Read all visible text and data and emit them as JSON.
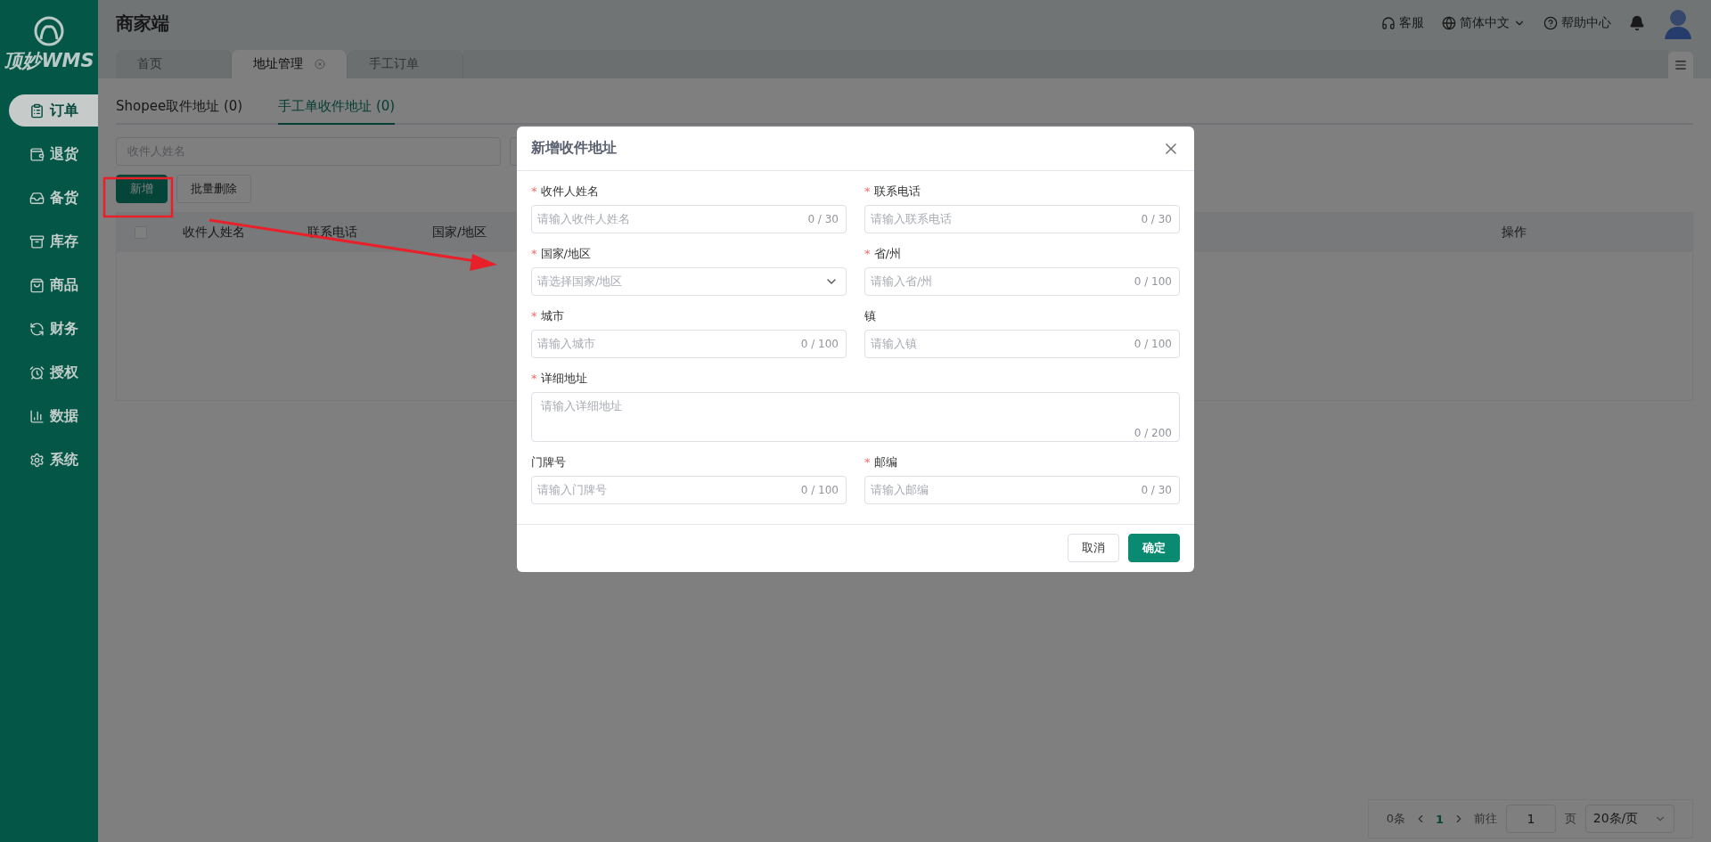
{
  "app": {
    "logo": "顶妙WMS",
    "title": "商家端"
  },
  "header_actions": [
    {
      "kind": "support",
      "label": "客服"
    },
    {
      "kind": "language",
      "label": "简体中文"
    },
    {
      "kind": "help",
      "label": "帮助中心"
    }
  ],
  "sidebar": {
    "items": [
      {
        "label": "订单",
        "selected": true
      },
      {
        "label": "退货",
        "selected": false
      },
      {
        "label": "备货",
        "selected": false
      },
      {
        "label": "库存",
        "selected": false
      },
      {
        "label": "商品",
        "selected": false
      },
      {
        "label": "财务",
        "selected": false
      },
      {
        "label": "授权",
        "selected": false
      },
      {
        "label": "数据",
        "selected": false
      },
      {
        "label": "系统",
        "selected": false
      }
    ]
  },
  "page_tabs": [
    {
      "label": "首页",
      "selected": false,
      "closable": false
    },
    {
      "label": "地址管理",
      "selected": true,
      "closable": true
    },
    {
      "label": "手工订单",
      "selected": false,
      "closable": false
    }
  ],
  "sub_tabs": [
    {
      "label": "Shopee取件地址 (0)",
      "selected": false
    },
    {
      "label": "手工单收件地址 (0)",
      "selected": true
    }
  ],
  "filter": {
    "placeholder": "收件人姓名"
  },
  "actions": [
    {
      "label": "新增",
      "kind": "primary",
      "highlighted": true
    },
    {
      "label": "批量删除",
      "kind": "default",
      "highlighted": false
    }
  ],
  "table": {
    "select_all": {
      "checked": false
    },
    "columns": [
      "收件人姓名",
      "联系电话",
      "国家/地区"
    ],
    "action_column": "操作"
  },
  "pagination": {
    "total": "0条",
    "pages": [
      {
        "label": "1",
        "selected": true
      }
    ],
    "goto_label": "前往",
    "goto_value": "1",
    "page_unit": "页",
    "page_size": "20条/页"
  },
  "dialog": {
    "title": "新增收件地址",
    "required_mark": "*",
    "fields": [
      {
        "kind": "input",
        "label": "收件人姓名",
        "required": true,
        "placeholder": "请输入收件人姓名",
        "counter": "0 / 30"
      },
      {
        "kind": "input",
        "label": "联系电话",
        "required": true,
        "placeholder": "请输入联系电话",
        "counter": "0 / 30"
      },
      {
        "kind": "select",
        "label": "国家/地区",
        "required": true,
        "placeholder": "请选择国家/地区"
      },
      {
        "kind": "input",
        "label": "省/州",
        "required": true,
        "placeholder": "请输入省/州",
        "counter": "0 / 100"
      },
      {
        "kind": "input",
        "label": "城市",
        "required": true,
        "placeholder": "请输入城市",
        "counter": "0 / 100"
      },
      {
        "kind": "input",
        "label": "镇",
        "required": false,
        "placeholder": "请输入镇",
        "counter": "0 / 100"
      },
      {
        "kind": "textarea",
        "label": "详细地址",
        "required": true,
        "placeholder": "请输入详细地址",
        "counter": "0 / 200"
      },
      {
        "kind": "input",
        "label": "门牌号",
        "required": false,
        "placeholder": "请输入门牌号",
        "counter": "0 / 100"
      },
      {
        "kind": "input",
        "label": "邮编",
        "required": true,
        "placeholder": "请输入邮编",
        "counter": "0 / 30"
      }
    ],
    "buttons": [
      {
        "label": "取消",
        "kind": "default"
      },
      {
        "label": "确定",
        "kind": "primary"
      }
    ]
  }
}
